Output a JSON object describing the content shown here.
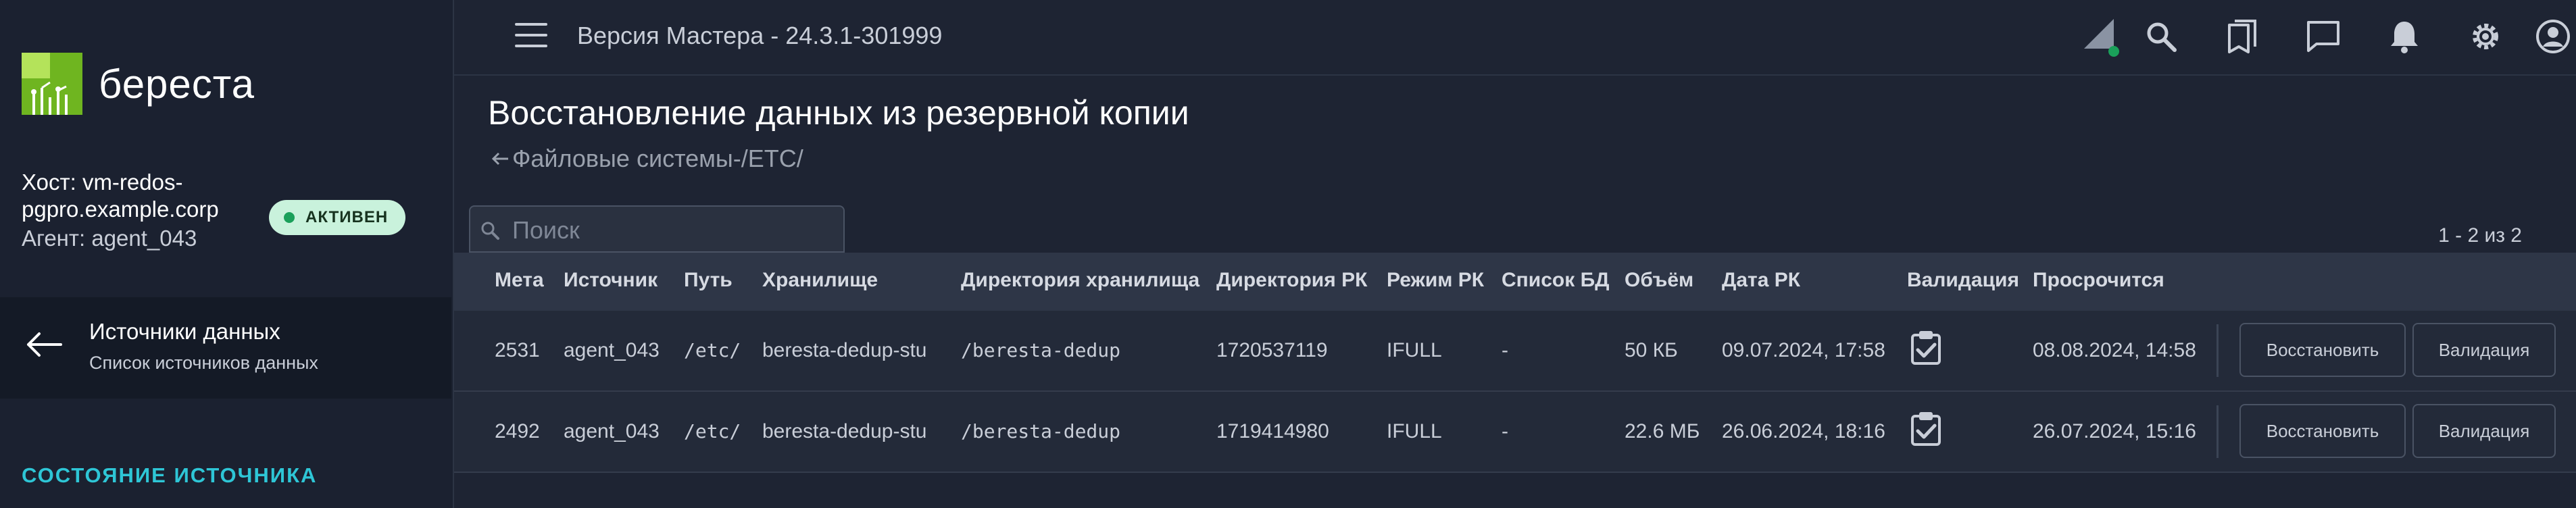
{
  "app": {
    "logo_text": "береста"
  },
  "sidebar": {
    "host": "Хост: vm-redos-pgpro.example.corp",
    "agent": "Агент: agent_043",
    "status_badge": "АКТИВЕН",
    "nav_title": "Источники данных",
    "nav_subtitle": "Список источников данных",
    "section_title": "СОСТОЯНИЕ ИСТОЧНИКА"
  },
  "topbar": {
    "version": "Версия Мастера - 24.3.1-301999",
    "icons": [
      "signal-icon",
      "search-icon",
      "bookmarks-icon",
      "chat-icon",
      "bell-icon",
      "gear-icon",
      "account-icon"
    ]
  },
  "page": {
    "title": "Восстановление данных из резервной копии",
    "breadcrumb_root": "Файловые системы",
    "breadcrumb_sep": "-",
    "breadcrumb_leaf": "/ETC/"
  },
  "search": {
    "placeholder": "Поиск"
  },
  "pager": {
    "label": "1 - 2 из 2"
  },
  "table": {
    "headers": [
      "Мета",
      "Источник",
      "Путь",
      "Хранилище",
      "Директория хранилища",
      "Директория РК",
      "Режим РК",
      "Список БД",
      "Объём",
      "Дата РК",
      "Валидация",
      "Просрочится"
    ],
    "rows": [
      {
        "meta": "2531",
        "source": "agent_043",
        "path": "/etc/",
        "storage": "beresta-dedup-stu",
        "storage_dir": "/beresta-dedup",
        "backup_dir": "1720537119",
        "mode": "IFULL",
        "db_list": "-",
        "size": "50 КБ",
        "date": "09.07.2024, 17:58",
        "expires": "08.08.2024, 14:58",
        "restore_label": "Восстановить",
        "validate_label": "Валидация"
      },
      {
        "meta": "2492",
        "source": "agent_043",
        "path": "/etc/",
        "storage": "beresta-dedup-stu",
        "storage_dir": "/beresta-dedup",
        "backup_dir": "1719414980",
        "mode": "IFULL",
        "db_list": "-",
        "size": "22.6 МБ",
        "date": "26.06.2024, 18:16",
        "expires": "26.07.2024, 15:16",
        "restore_label": "Восстановить",
        "validate_label": "Валидация"
      }
    ]
  },
  "colors": {
    "accent": "#2ec6d6",
    "badge_bg": "#c9f2dc",
    "status_dot": "#1aa05a",
    "logo_green": "#6fb520"
  }
}
